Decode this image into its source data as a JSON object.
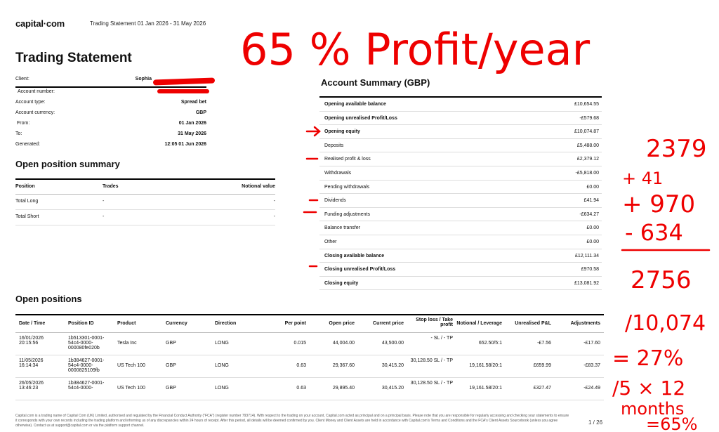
{
  "header": {
    "logo": "capital·com",
    "statement_period": "Trading Statement 01 Jan 2026 - 31 May 2026"
  },
  "title": "Trading Statement",
  "client": [
    {
      "label": "Client:",
      "value": "Sophia"
    },
    {
      "label": "Account number:",
      "value": ""
    },
    {
      "label": "Account type:",
      "value": "Spread bet"
    },
    {
      "label": "Account currency:",
      "value": "GBP"
    },
    {
      "label": "From:",
      "value": "01 Jan 2026"
    },
    {
      "label": "To:",
      "value": "31 May 2026"
    },
    {
      "label": "Generated:",
      "value": "12:05 01 Jun 2026"
    }
  ],
  "open_position_summary": {
    "title": "Open position summary",
    "headers": [
      "Position",
      "Trades",
      "Notional value"
    ],
    "rows": [
      [
        "Total Long",
        "-",
        "-"
      ],
      [
        "Total Short",
        "-",
        "-"
      ]
    ]
  },
  "account_summary": {
    "title": "Account Summary (GBP)",
    "rows": [
      {
        "label": "Opening available balance",
        "value": "£10,654.55",
        "bold": true
      },
      {
        "label": "Opening unrealised Profit/Loss",
        "value": "-£579.68",
        "bold": true
      },
      {
        "label": "Opening equity",
        "value": "£10,074.87",
        "bold": true
      },
      {
        "label": "Deposits",
        "value": "£5,488.00",
        "bold": false
      },
      {
        "label": "Realised profit & loss",
        "value": "£2,379.12",
        "bold": false
      },
      {
        "label": "Withdrawals",
        "value": "-£5,818.00",
        "bold": false
      },
      {
        "label": "Pending withdrawals",
        "value": "£0.00",
        "bold": false
      },
      {
        "label": "Dividends",
        "value": "£41.94",
        "bold": false
      },
      {
        "label": "Funding adjustments",
        "value": "-£634.27",
        "bold": false
      },
      {
        "label": "Balance transfer",
        "value": "£0.00",
        "bold": false
      },
      {
        "label": "Other",
        "value": "£0.00",
        "bold": false
      },
      {
        "label": "Closing available balance",
        "value": "£12,111.34",
        "bold": true
      },
      {
        "label": "Closing unrealised Profit/Loss",
        "value": "£970.58",
        "bold": true
      },
      {
        "label": "Closing equity",
        "value": "£13,081.92",
        "bold": true
      }
    ]
  },
  "open_positions": {
    "title": "Open positions",
    "headers": [
      "Date / Time",
      "Position ID",
      "Product",
      "Currency",
      "Direction",
      "Per point",
      "Open price",
      "Current price",
      "Stop loss / Take profit",
      "Notional / Leverage",
      "Unrealised P&L",
      "Adjustments"
    ],
    "rows": [
      [
        "16/01/2026 20:15:56",
        "1b513301-0001-54c4-0000-000080fe020b",
        "Tesla Inc",
        "GBP",
        "LONG",
        "0.015",
        "44,004.00",
        "43,500.00",
        "- SL / - TP",
        "652.50/5:1",
        "-£7.56",
        "-£17.60"
      ],
      [
        "11/05/2026 16:14:34",
        "1b384627-0001-54c4-0000-0000825109fb",
        "US Tech 100",
        "GBP",
        "LONG",
        "0.63",
        "29,367.60",
        "30,415.20",
        "30,128.50 SL / - TP",
        "19,161.58/20:1",
        "£659.99",
        "-£83.37"
      ],
      [
        "26/05/2026 13:46:23",
        "1b384627-0001-54c4-0000-",
        "US Tech 100",
        "GBP",
        "LONG",
        "0.63",
        "29,895.40",
        "30,415.20",
        "30,128.50 SL / - TP",
        "19,161.58/20:1",
        "£327.47",
        "-£24.49"
      ]
    ]
  },
  "footer": {
    "text": "Capital.com is a trading name of Capital Com (UK) Limited, authorised and regulated by the Financial Conduct Authority (\"FCA\") (register number 793714). With respect to the trading on your account, Capital.com acted as principal and on a principal basis. Please note that you are responsible for regularly accessing and checking your statements to ensure it corresponds with your own records including the trading platform and informing us of any discrepancies within 24 hours of receipt. After this period, all details will be deemed confirmed by you. Client Money and Client Assets are held in accordance with Capital.com's Terms and Conditions and the FCA's Client Assets Sourcebook (unless you agree otherwise). Contact us at support@capital.com or via the platform support channel.",
    "page": "1 / 26"
  },
  "annotations": {
    "headline": "65 % Profit/year",
    "calc_lines": [
      "2379",
      "+ 41",
      "+ 970",
      "- 634",
      "2756",
      "/10,074",
      "= 27%",
      "/5 × 12",
      "months",
      "=65%"
    ],
    "ink_color": "#e00000"
  }
}
